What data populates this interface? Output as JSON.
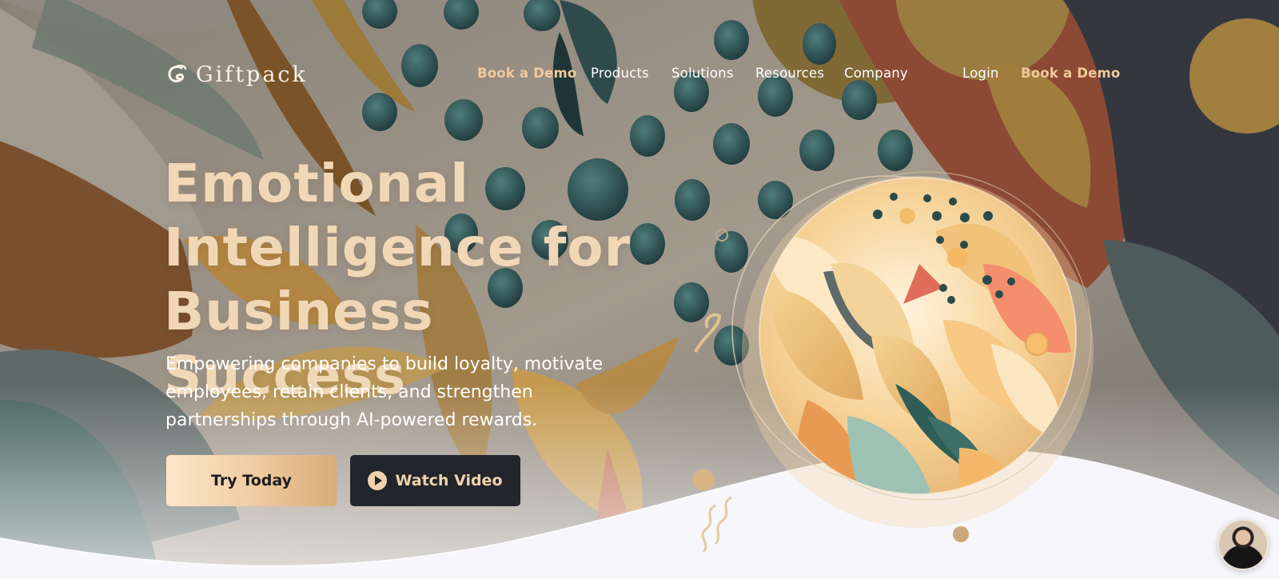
{
  "brand": {
    "name": "Giftpack",
    "colors": {
      "accent_gold": "#f1c99b",
      "dark": "#23252d",
      "headline": "#f0d7b6",
      "white": "#ffffff"
    }
  },
  "nav": {
    "links": [
      {
        "label": "Book a Demo",
        "style": "accent"
      },
      {
        "label": "Products"
      },
      {
        "label": "Solutions"
      },
      {
        "label": "Resources"
      },
      {
        "label": "Company"
      }
    ],
    "login_label": "Login",
    "cta_label": "Book a Demo"
  },
  "hero": {
    "headline_lines": [
      "Emotional",
      "Intelligence for",
      "Business Success"
    ],
    "subheadline": "Empowering companies to build loyalty, motivate employees, retain clients, and strengthen partnerships through AI-powered rewards.",
    "primary_button": "Try Today",
    "secondary_button": "Watch Video"
  },
  "icons": {
    "logo": "giftpack-logo-icon",
    "play": "play-icon",
    "chat": "chat-avatar"
  }
}
